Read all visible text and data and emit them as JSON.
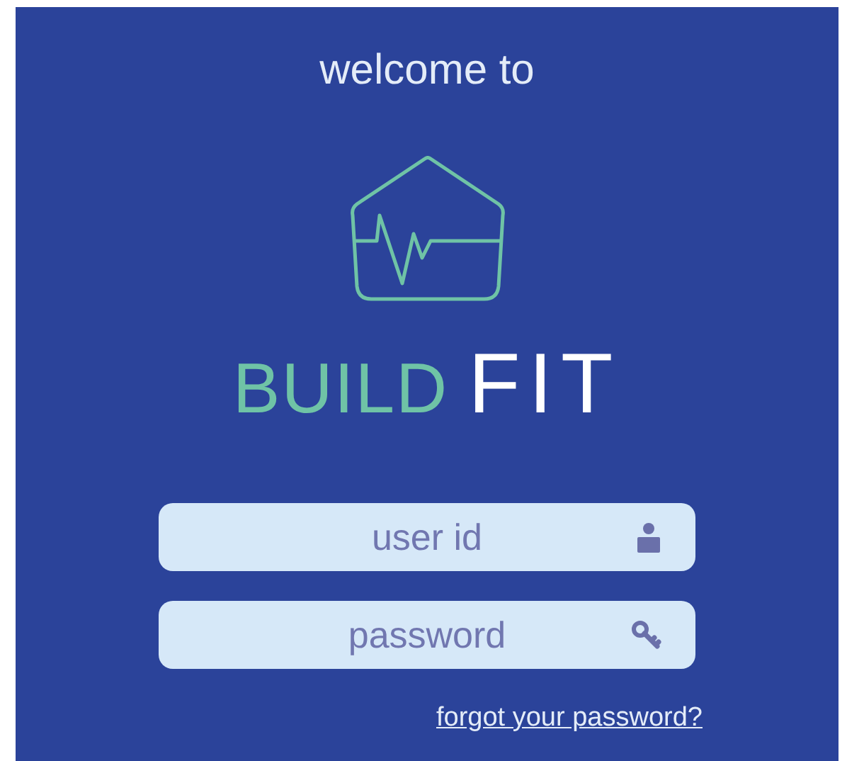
{
  "greeting": "welcome to",
  "brand": {
    "first": "BUILD",
    "second": "FIT"
  },
  "fields": [
    {
      "kind": "user",
      "placeholder": "user id"
    },
    {
      "kind": "password",
      "placeholder": "password"
    }
  ],
  "link": "forgot your password?"
}
